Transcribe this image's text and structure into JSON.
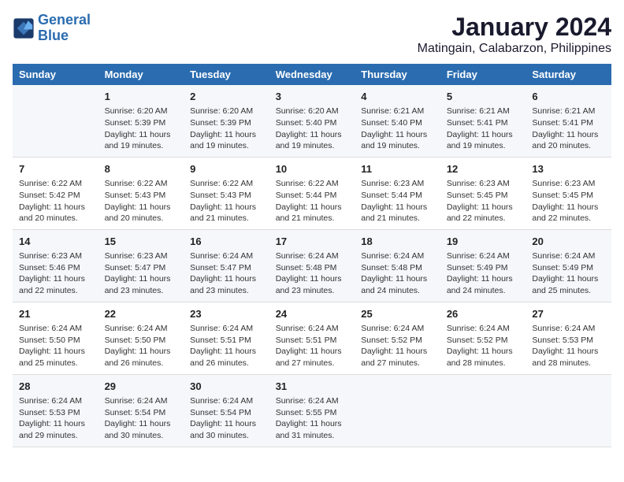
{
  "logo": {
    "line1": "General",
    "line2": "Blue"
  },
  "title": "January 2024",
  "subtitle": "Matingain, Calabarzon, Philippines",
  "days": [
    "Sunday",
    "Monday",
    "Tuesday",
    "Wednesday",
    "Thursday",
    "Friday",
    "Saturday"
  ],
  "weeks": [
    [
      {
        "num": "",
        "lines": []
      },
      {
        "num": "1",
        "lines": [
          "Sunrise: 6:20 AM",
          "Sunset: 5:39 PM",
          "Daylight: 11 hours",
          "and 19 minutes."
        ]
      },
      {
        "num": "2",
        "lines": [
          "Sunrise: 6:20 AM",
          "Sunset: 5:39 PM",
          "Daylight: 11 hours",
          "and 19 minutes."
        ]
      },
      {
        "num": "3",
        "lines": [
          "Sunrise: 6:20 AM",
          "Sunset: 5:40 PM",
          "Daylight: 11 hours",
          "and 19 minutes."
        ]
      },
      {
        "num": "4",
        "lines": [
          "Sunrise: 6:21 AM",
          "Sunset: 5:40 PM",
          "Daylight: 11 hours",
          "and 19 minutes."
        ]
      },
      {
        "num": "5",
        "lines": [
          "Sunrise: 6:21 AM",
          "Sunset: 5:41 PM",
          "Daylight: 11 hours",
          "and 19 minutes."
        ]
      },
      {
        "num": "6",
        "lines": [
          "Sunrise: 6:21 AM",
          "Sunset: 5:41 PM",
          "Daylight: 11 hours",
          "and 20 minutes."
        ]
      }
    ],
    [
      {
        "num": "7",
        "lines": [
          "Sunrise: 6:22 AM",
          "Sunset: 5:42 PM",
          "Daylight: 11 hours",
          "and 20 minutes."
        ]
      },
      {
        "num": "8",
        "lines": [
          "Sunrise: 6:22 AM",
          "Sunset: 5:43 PM",
          "Daylight: 11 hours",
          "and 20 minutes."
        ]
      },
      {
        "num": "9",
        "lines": [
          "Sunrise: 6:22 AM",
          "Sunset: 5:43 PM",
          "Daylight: 11 hours",
          "and 21 minutes."
        ]
      },
      {
        "num": "10",
        "lines": [
          "Sunrise: 6:22 AM",
          "Sunset: 5:44 PM",
          "Daylight: 11 hours",
          "and 21 minutes."
        ]
      },
      {
        "num": "11",
        "lines": [
          "Sunrise: 6:23 AM",
          "Sunset: 5:44 PM",
          "Daylight: 11 hours",
          "and 21 minutes."
        ]
      },
      {
        "num": "12",
        "lines": [
          "Sunrise: 6:23 AM",
          "Sunset: 5:45 PM",
          "Daylight: 11 hours",
          "and 22 minutes."
        ]
      },
      {
        "num": "13",
        "lines": [
          "Sunrise: 6:23 AM",
          "Sunset: 5:45 PM",
          "Daylight: 11 hours",
          "and 22 minutes."
        ]
      }
    ],
    [
      {
        "num": "14",
        "lines": [
          "Sunrise: 6:23 AM",
          "Sunset: 5:46 PM",
          "Daylight: 11 hours",
          "and 22 minutes."
        ]
      },
      {
        "num": "15",
        "lines": [
          "Sunrise: 6:23 AM",
          "Sunset: 5:47 PM",
          "Daylight: 11 hours",
          "and 23 minutes."
        ]
      },
      {
        "num": "16",
        "lines": [
          "Sunrise: 6:24 AM",
          "Sunset: 5:47 PM",
          "Daylight: 11 hours",
          "and 23 minutes."
        ]
      },
      {
        "num": "17",
        "lines": [
          "Sunrise: 6:24 AM",
          "Sunset: 5:48 PM",
          "Daylight: 11 hours",
          "and 23 minutes."
        ]
      },
      {
        "num": "18",
        "lines": [
          "Sunrise: 6:24 AM",
          "Sunset: 5:48 PM",
          "Daylight: 11 hours",
          "and 24 minutes."
        ]
      },
      {
        "num": "19",
        "lines": [
          "Sunrise: 6:24 AM",
          "Sunset: 5:49 PM",
          "Daylight: 11 hours",
          "and 24 minutes."
        ]
      },
      {
        "num": "20",
        "lines": [
          "Sunrise: 6:24 AM",
          "Sunset: 5:49 PM",
          "Daylight: 11 hours",
          "and 25 minutes."
        ]
      }
    ],
    [
      {
        "num": "21",
        "lines": [
          "Sunrise: 6:24 AM",
          "Sunset: 5:50 PM",
          "Daylight: 11 hours",
          "and 25 minutes."
        ]
      },
      {
        "num": "22",
        "lines": [
          "Sunrise: 6:24 AM",
          "Sunset: 5:50 PM",
          "Daylight: 11 hours",
          "and 26 minutes."
        ]
      },
      {
        "num": "23",
        "lines": [
          "Sunrise: 6:24 AM",
          "Sunset: 5:51 PM",
          "Daylight: 11 hours",
          "and 26 minutes."
        ]
      },
      {
        "num": "24",
        "lines": [
          "Sunrise: 6:24 AM",
          "Sunset: 5:51 PM",
          "Daylight: 11 hours",
          "and 27 minutes."
        ]
      },
      {
        "num": "25",
        "lines": [
          "Sunrise: 6:24 AM",
          "Sunset: 5:52 PM",
          "Daylight: 11 hours",
          "and 27 minutes."
        ]
      },
      {
        "num": "26",
        "lines": [
          "Sunrise: 6:24 AM",
          "Sunset: 5:52 PM",
          "Daylight: 11 hours",
          "and 28 minutes."
        ]
      },
      {
        "num": "27",
        "lines": [
          "Sunrise: 6:24 AM",
          "Sunset: 5:53 PM",
          "Daylight: 11 hours",
          "and 28 minutes."
        ]
      }
    ],
    [
      {
        "num": "28",
        "lines": [
          "Sunrise: 6:24 AM",
          "Sunset: 5:53 PM",
          "Daylight: 11 hours",
          "and 29 minutes."
        ]
      },
      {
        "num": "29",
        "lines": [
          "Sunrise: 6:24 AM",
          "Sunset: 5:54 PM",
          "Daylight: 11 hours",
          "and 30 minutes."
        ]
      },
      {
        "num": "30",
        "lines": [
          "Sunrise: 6:24 AM",
          "Sunset: 5:54 PM",
          "Daylight: 11 hours",
          "and 30 minutes."
        ]
      },
      {
        "num": "31",
        "lines": [
          "Sunrise: 6:24 AM",
          "Sunset: 5:55 PM",
          "Daylight: 11 hours",
          "and 31 minutes."
        ]
      },
      {
        "num": "",
        "lines": []
      },
      {
        "num": "",
        "lines": []
      },
      {
        "num": "",
        "lines": []
      }
    ]
  ]
}
